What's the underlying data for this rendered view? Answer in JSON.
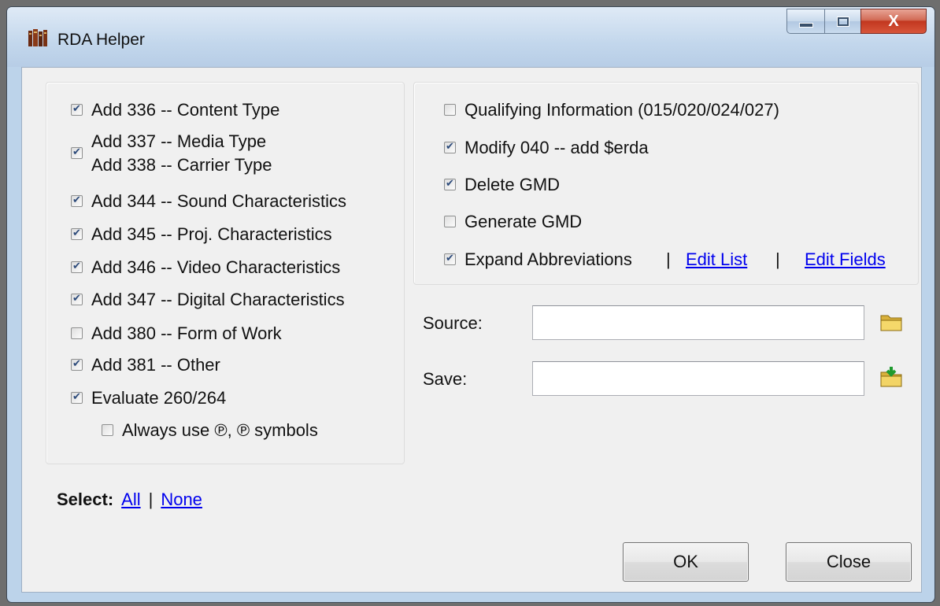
{
  "window": {
    "title": "RDA Helper",
    "close_glyph": "X"
  },
  "left_options": [
    {
      "label": "Add 336 -- Content Type",
      "checked": true
    },
    {
      "label": "Add 337 -- Media Type",
      "label2": "Add 338 -- Carrier Type",
      "checked": true
    },
    {
      "label": "Add 344 -- Sound Characteristics",
      "checked": true
    },
    {
      "label": "Add 345 -- Proj. Characteristics",
      "checked": true
    },
    {
      "label": "Add 346 -- Video Characteristics",
      "checked": true
    },
    {
      "label": "Add 347 -- Digital Characteristics",
      "checked": true
    },
    {
      "label": "Add 380 -- Form of Work",
      "checked": false
    },
    {
      "label": "Add 381 -- Other",
      "checked": true
    },
    {
      "label": "Evaluate 260/264",
      "checked": true
    },
    {
      "label": "Always use ℗, ℗ symbols",
      "checked": false
    }
  ],
  "right_options": [
    {
      "label": "Qualifying Information (015/020/024/027)",
      "checked": false
    },
    {
      "label": "Modify 040 -- add $erda",
      "checked": true
    },
    {
      "label": "Delete GMD",
      "checked": true
    },
    {
      "label": "Generate GMD",
      "checked": false
    },
    {
      "label": "Expand Abbreviations",
      "checked": true
    }
  ],
  "links": {
    "edit_list": "Edit List",
    "edit_fields": "Edit Fields",
    "separator": "|"
  },
  "fields": {
    "source_label": "Source:",
    "source_value": "",
    "save_label": "Save:",
    "save_value": ""
  },
  "select": {
    "label": "Select:",
    "all": "All",
    "separator": "|",
    "none": "None"
  },
  "buttons": {
    "ok": "OK",
    "close": "Close"
  },
  "colors": {
    "titlebar": "#c3d7ec",
    "close_button": "#c2371f",
    "link": "#0000ee",
    "dialog_bg": "#f0f0f0"
  }
}
